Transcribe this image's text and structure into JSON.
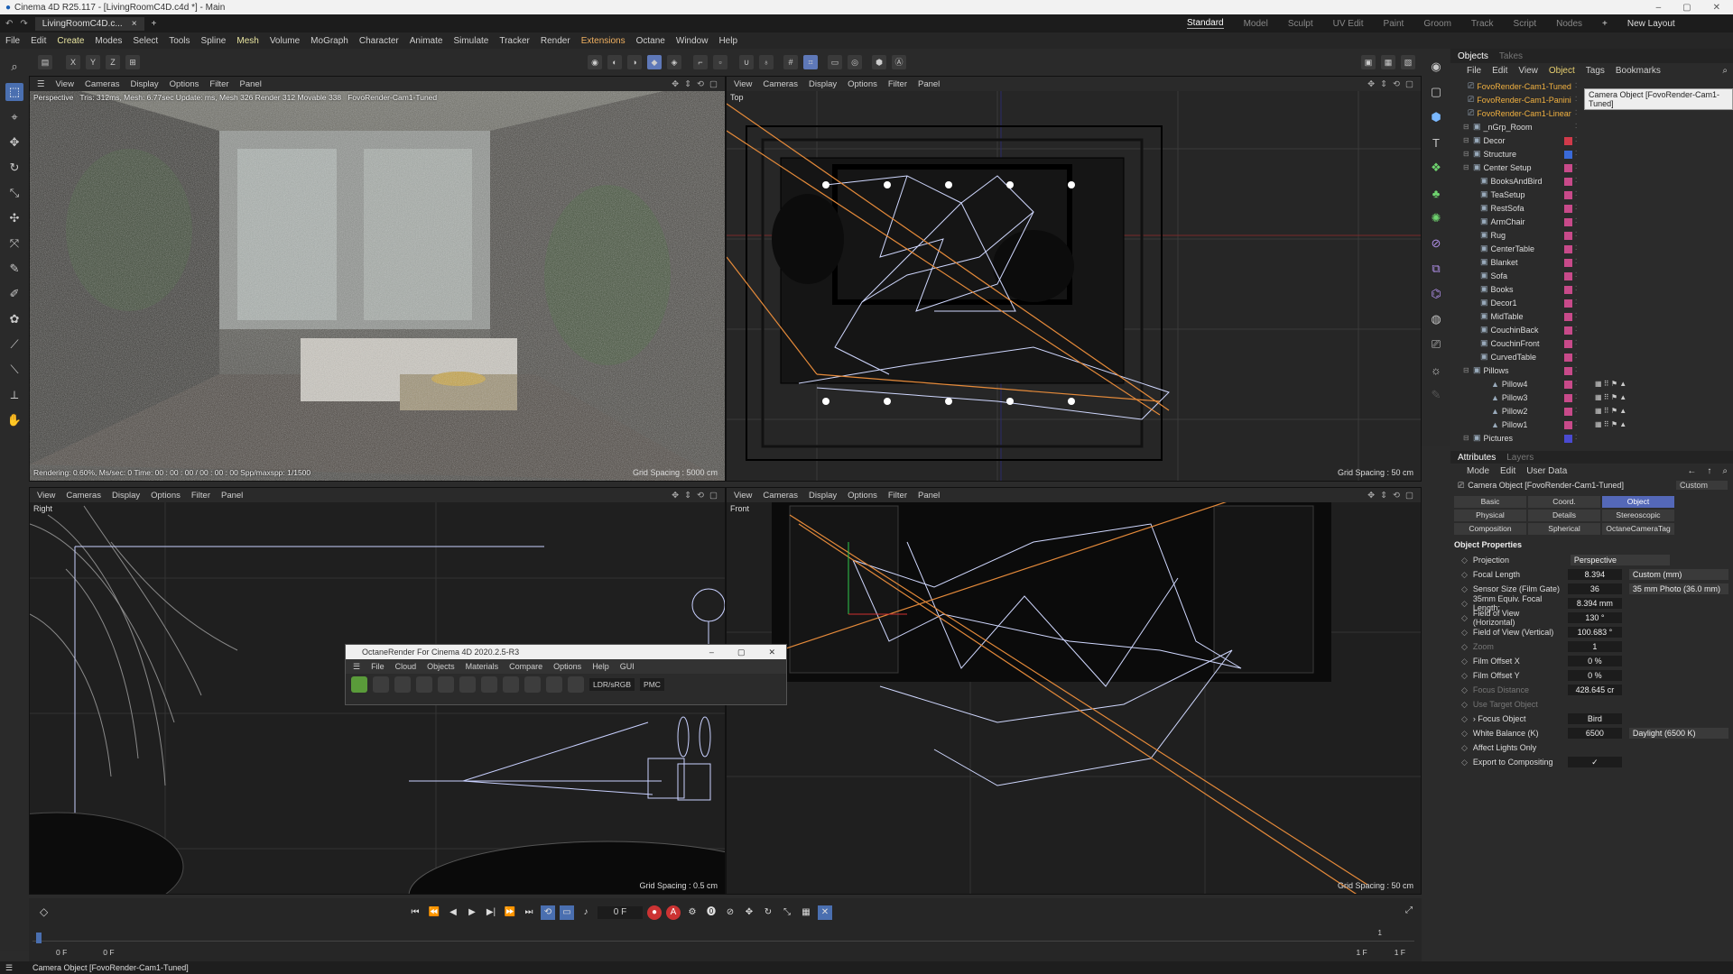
{
  "window": {
    "title": "Cinema 4D R25.117 - [LivingRoomC4D.c4d *] - Main",
    "controls": [
      "–",
      "▢",
      "✕"
    ]
  },
  "doc_tab": {
    "name": "LivingRoomC4D.c...",
    "close": "×",
    "add": "+"
  },
  "layouts": [
    "Standard",
    "Model",
    "Sculpt",
    "UV Edit",
    "Paint",
    "Groom",
    "Track",
    "Script",
    "Nodes"
  ],
  "new_layout": "New Layout",
  "menu": [
    "File",
    "Edit",
    "Create",
    "Modes",
    "Select",
    "Tools",
    "Spline",
    "Mesh",
    "Volume",
    "MoGraph",
    "Character",
    "Animate",
    "Simulate",
    "Tracker",
    "Render",
    "Extensions",
    "Octane",
    "Window",
    "Help"
  ],
  "axis_buttons": [
    "X",
    "Y",
    "Z"
  ],
  "viewport_menu": [
    "View",
    "Cameras",
    "Display",
    "Options",
    "Filter",
    "Panel"
  ],
  "viewports": {
    "perspective": {
      "label": "Perspective",
      "stats": "Tris: 312ms, Mesh: 6.77sec Update: ms, Mesh 326 Render 312 Movable 338",
      "camera": "FovoRender-Cam1-Tuned",
      "render_status": "Rendering: 0.60%, Ms/sec: 0 Time: 00 : 00 : 00 / 00 : 00 : 00 Spp/maxspp: 1/1500",
      "grid": "Grid Spacing : 5000 cm"
    },
    "top": {
      "label": "Top",
      "grid": "Grid Spacing : 50 cm"
    },
    "right": {
      "label": "Right",
      "grid": "Grid Spacing : 0.5 cm"
    },
    "front": {
      "label": "Front",
      "grid": "Grid Spacing : 50 cm"
    }
  },
  "octane_window": {
    "title": "OctaneRender For Cinema 4D 2020.2.5-R3",
    "menu": [
      "File",
      "Cloud",
      "Objects",
      "Materials",
      "Compare",
      "Options",
      "Help",
      "GUI"
    ],
    "colorspace": "LDR/sRGB",
    "kernel": "PMC"
  },
  "objects_panel": {
    "tabs": [
      "Objects",
      "Takes"
    ],
    "menu": [
      "File",
      "Edit",
      "View",
      "Object",
      "Tags",
      "Bookmarks"
    ],
    "tooltip": "Camera Object [FovoRender-Cam1-Tuned]",
    "items": [
      {
        "name": "FovoRender-Cam1-Tuned",
        "type": "cam",
        "color": ""
      },
      {
        "name": "FovoRender-Cam1-Panini",
        "type": "cam",
        "color": ""
      },
      {
        "name": "FovoRender-Cam1-Linear",
        "type": "cam",
        "color": ""
      },
      {
        "name": "_nGrp_Room",
        "type": "grp",
        "color": ""
      },
      {
        "name": "Decor",
        "type": "grp",
        "color": "#d03a4a"
      },
      {
        "name": "Structure",
        "type": "grp",
        "color": "#3a6ad8"
      },
      {
        "name": "Center Setup",
        "type": "grp",
        "color": "#c84a8a"
      },
      {
        "name": "BooksAndBird",
        "type": "obj",
        "color": "#c84a8a"
      },
      {
        "name": "TeaSetup",
        "type": "obj",
        "color": "#c84a8a"
      },
      {
        "name": "RestSofa",
        "type": "obj",
        "color": "#c84a8a"
      },
      {
        "name": "ArmChair",
        "type": "obj",
        "color": "#c84a8a"
      },
      {
        "name": "Rug",
        "type": "obj",
        "color": "#c84a8a"
      },
      {
        "name": "CenterTable",
        "type": "obj",
        "color": "#c84a8a"
      },
      {
        "name": "Blanket",
        "type": "obj",
        "color": "#c84a8a"
      },
      {
        "name": "Sofa",
        "type": "obj",
        "color": "#c84a8a"
      },
      {
        "name": "Books",
        "type": "obj",
        "color": "#c84a8a"
      },
      {
        "name": "Decor1",
        "type": "obj",
        "color": "#c84a8a"
      },
      {
        "name": "MidTable",
        "type": "obj",
        "color": "#c84a8a"
      },
      {
        "name": "CouchinBack",
        "type": "obj",
        "color": "#c84a8a"
      },
      {
        "name": "CouchinFront",
        "type": "obj",
        "color": "#c84a8a"
      },
      {
        "name": "CurvedTable",
        "type": "obj",
        "color": "#c84a8a"
      },
      {
        "name": "Pillows",
        "type": "grp",
        "color": "#c84a8a"
      },
      {
        "name": "Pillow4",
        "type": "sub",
        "color": "#c84a8a"
      },
      {
        "name": "Pillow3",
        "type": "sub",
        "color": "#c84a8a"
      },
      {
        "name": "Pillow2",
        "type": "sub",
        "color": "#c84a8a"
      },
      {
        "name": "Pillow1",
        "type": "sub",
        "color": "#c84a8a"
      },
      {
        "name": "Pictures",
        "type": "grp",
        "color": "#4a4ad0"
      }
    ]
  },
  "attributes_panel": {
    "tabs": [
      "Attributes",
      "Layers"
    ],
    "menu": [
      "Mode",
      "Edit",
      "User Data"
    ],
    "object": "Camera Object [FovoRender-Cam1-Tuned]",
    "preset": "Custom",
    "buttons": [
      "Basic",
      "Coord.",
      "Object",
      "Physical",
      "Details",
      "Stereoscopic",
      "Composition",
      "Spherical",
      "OctaneCameraTag"
    ],
    "active_button": "Object",
    "section": "Object Properties",
    "properties": [
      {
        "label": "Projection",
        "value": "",
        "select": "Perspective",
        "enabled": true
      },
      {
        "label": "Focal Length",
        "value": "8.394",
        "select": "Custom (mm)",
        "enabled": true
      },
      {
        "label": "Sensor Size (Film Gate)",
        "value": "36",
        "select": "35 mm Photo (36.0 mm)",
        "enabled": true
      },
      {
        "label": "35mm Equiv. Focal Length:",
        "value": "8.394 mm",
        "select": "",
        "enabled": true
      },
      {
        "label": "Field of View (Horizontal)",
        "value": "130 °",
        "select": "",
        "enabled": true
      },
      {
        "label": "Field of View (Vertical)",
        "value": "100.683 °",
        "select": "",
        "enabled": true
      },
      {
        "label": "Zoom",
        "value": "1",
        "select": "",
        "enabled": false
      },
      {
        "label": "Film Offset X",
        "value": "0 %",
        "select": "",
        "enabled": true
      },
      {
        "label": "Film Offset Y",
        "value": "0 %",
        "select": "",
        "enabled": true
      },
      {
        "label": "Focus Distance",
        "value": "428.645 cr",
        "select": "",
        "enabled": false
      },
      {
        "label": "Use Target Object",
        "value": "",
        "select": "",
        "enabled": false
      },
      {
        "label": "› Focus Object",
        "value": "Bird",
        "select": "",
        "enabled": true
      },
      {
        "label": "White Balance (K)",
        "value": "6500",
        "select": "Daylight (6500 K)",
        "enabled": true
      },
      {
        "label": "Affect Lights Only",
        "value": "",
        "select": "",
        "enabled": true
      },
      {
        "label": "Export to Compositing",
        "value": "✓",
        "select": "",
        "enabled": true
      }
    ]
  },
  "timeline": {
    "frame": "0 F",
    "start": "0 F",
    "start2": "0 F",
    "end": "1 F",
    "end2": "1 F",
    "marker": "1"
  },
  "status": "Camera Object [FovoRender-Cam1-Tuned]"
}
